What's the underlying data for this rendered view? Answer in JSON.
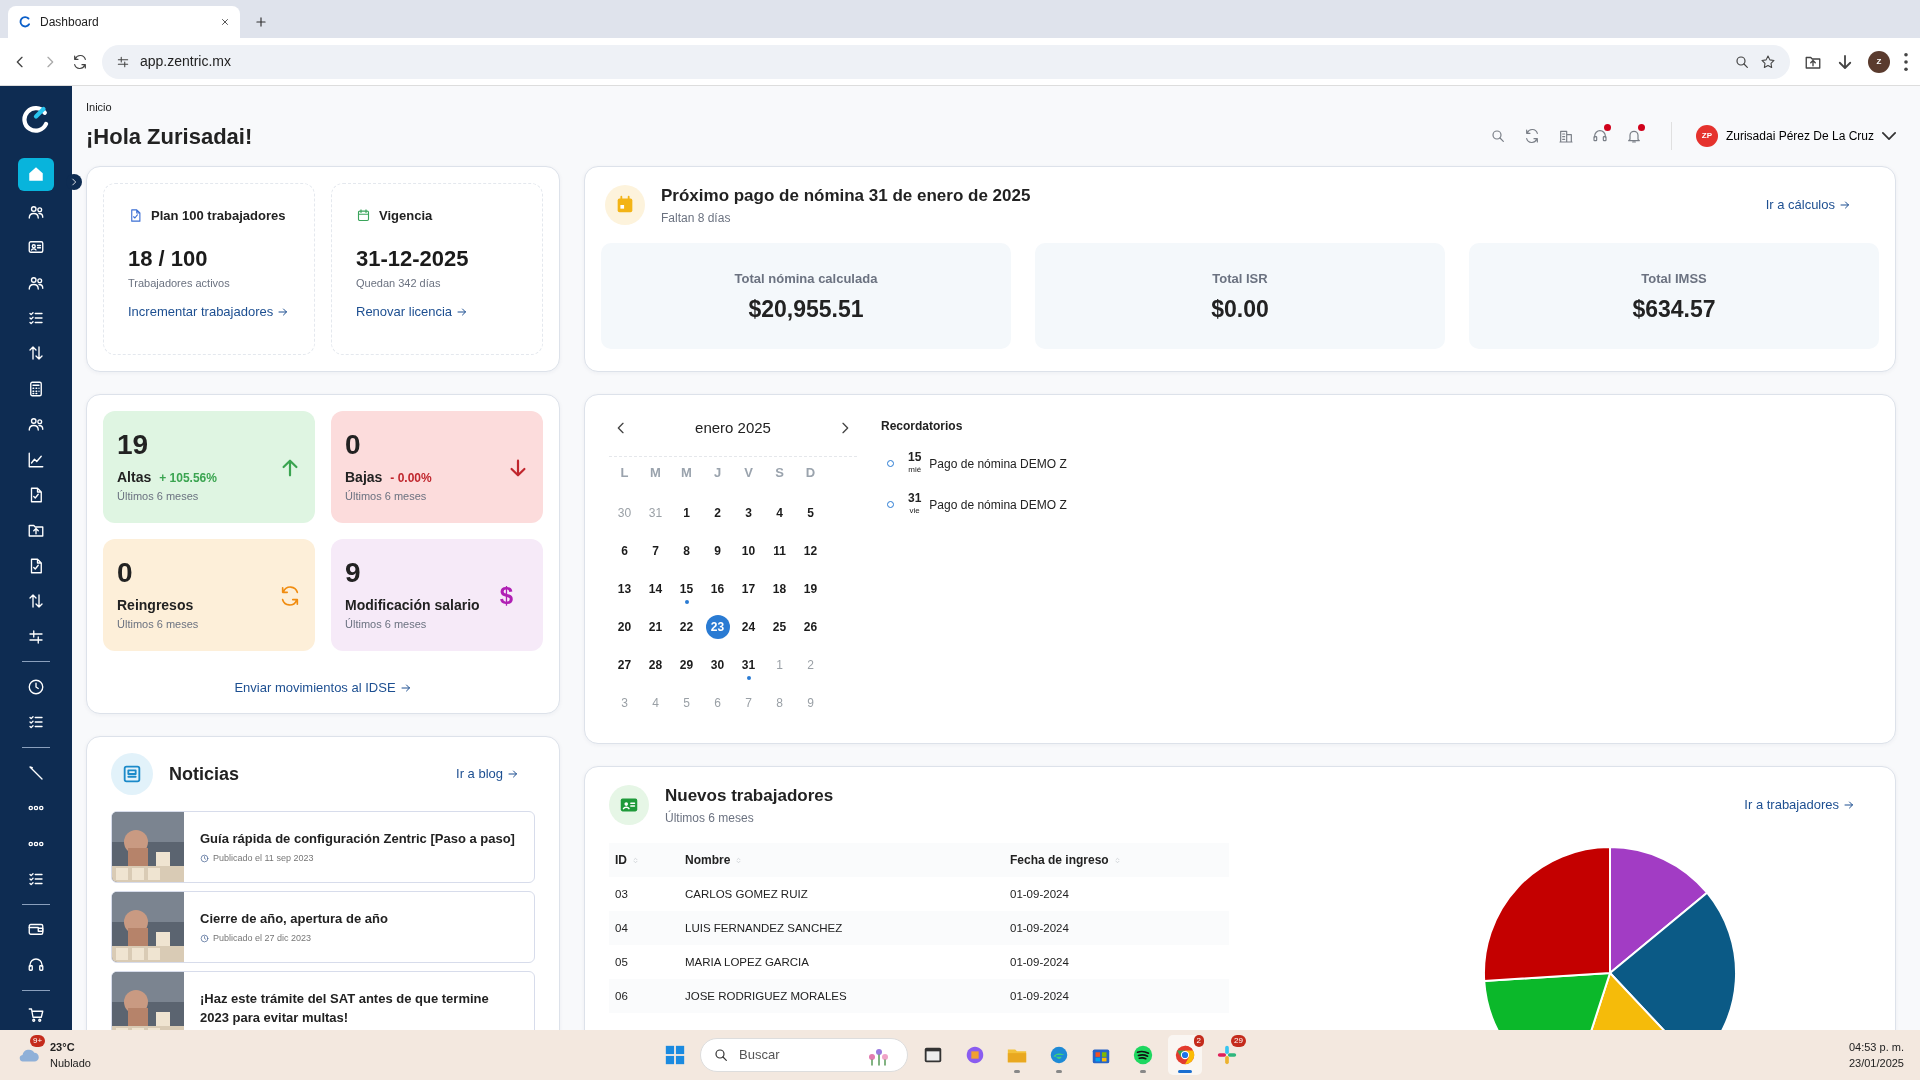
{
  "browser": {
    "tab_title": "Dashboard",
    "url": "app.zentric.mx",
    "profile_initial": "Z"
  },
  "sidebar": {
    "items": [
      {
        "kind": "link",
        "selected": true
      },
      {
        "kind": "link",
        "selected": false
      },
      {
        "kind": "link",
        "selected": false
      },
      {
        "kind": "link",
        "selected": false
      },
      {
        "kind": "link",
        "selected": false
      },
      {
        "kind": "link",
        "selected": false
      },
      {
        "kind": "link",
        "selected": false
      },
      {
        "kind": "link",
        "selected": false
      },
      {
        "kind": "link",
        "selected": false
      },
      {
        "kind": "link",
        "selected": false
      },
      {
        "kind": "link",
        "selected": false
      },
      {
        "kind": "link",
        "selected": false
      },
      {
        "kind": "link",
        "selected": false
      },
      {
        "kind": "link",
        "selected": false
      },
      {
        "kind": "divider"
      },
      {
        "kind": "link",
        "selected": false
      },
      {
        "kind": "link",
        "selected": false
      },
      {
        "kind": "divider"
      },
      {
        "kind": "link",
        "selected": false
      },
      {
        "kind": "link",
        "selected": false
      },
      {
        "kind": "link",
        "selected": false
      },
      {
        "kind": "link",
        "selected": false
      },
      {
        "kind": "divider"
      },
      {
        "kind": "link",
        "selected": false
      },
      {
        "kind": "link",
        "selected": false
      },
      {
        "kind": "divider"
      },
      {
        "kind": "link",
        "selected": false
      }
    ]
  },
  "header": {
    "breadcrumb": "Inicio",
    "greeting": "¡Hola Zurisadai!",
    "toolbar": [
      {
        "alert": false
      },
      {
        "alert": false
      },
      {
        "alert": false
      },
      {
        "alert": true
      },
      {
        "alert": true
      }
    ],
    "user": {
      "initials": "ZP",
      "name": "Zurisadai Pérez De La Cruz"
    }
  },
  "plan_cards": [
    {
      "kind": "plan",
      "title": "Plan 100 trabajadores",
      "value": "18 / 100",
      "caption": "Trabajadores activos",
      "link": "Incrementar trabajadores"
    },
    {
      "kind": "validity",
      "title": "Vigencia",
      "value": "31-12-2025",
      "caption": "Quedan 342 días",
      "link": "Renovar licencia"
    }
  ],
  "movements": {
    "tiles": [
      {
        "kind": "up",
        "value": "19",
        "label": "Altas",
        "change": "+ 105.56%",
        "caption": "Últimos 6 meses"
      },
      {
        "kind": "down",
        "value": "0",
        "label": "Bajas",
        "change": "- 0.00%",
        "caption": "Últimos 6 meses"
      },
      {
        "kind": "return",
        "value": "0",
        "label": "Reingresos",
        "caption": "Últimos 6 meses"
      },
      {
        "kind": "salary",
        "value": "9",
        "label": "Modificación salario",
        "caption": "Últimos 6 meses",
        "symbol": "$"
      }
    ],
    "link": "Enviar movimientos al IDSE"
  },
  "news": {
    "title": "Noticias",
    "link": "Ir a blog",
    "items": [
      {
        "title": "Guía rápida de configuración Zentric [Paso a paso]",
        "date": "Publicado el 11 sep 2023"
      },
      {
        "title": "Cierre de año, apertura de año",
        "date": "Publicado el 27 dic 2023"
      },
      {
        "title": "¡Haz este trámite del SAT antes de que termine 2023 para evitar multas!"
      }
    ]
  },
  "payroll": {
    "title": "Próximo pago de nómina 31 de enero de 2025",
    "subtitle": "Faltan 8 días",
    "link": "Ir a cálculos",
    "totals": [
      {
        "label": "Total nómina calculada",
        "value": "$20,955.51"
      },
      {
        "label": "Total ISR",
        "value": "$0.00"
      },
      {
        "label": "Total IMSS",
        "value": "$634.57"
      }
    ]
  },
  "calendar": {
    "month": "enero 2025",
    "weekdays": [
      "L",
      "M",
      "M",
      "J",
      "V",
      "S",
      "D"
    ],
    "days": [
      {
        "day": "30",
        "outside": true,
        "event": false,
        "selected": false
      },
      {
        "day": "31",
        "outside": true,
        "event": false,
        "selected": false
      },
      {
        "day": "1",
        "outside": false,
        "event": false,
        "selected": false
      },
      {
        "day": "2",
        "outside": false,
        "event": false,
        "selected": false
      },
      {
        "day": "3",
        "outside": false,
        "event": false,
        "selected": false
      },
      {
        "day": "4",
        "outside": false,
        "event": false,
        "selected": false
      },
      {
        "day": "5",
        "outside": false,
        "event": false,
        "selected": false
      },
      {
        "day": "6",
        "outside": false,
        "event": false,
        "selected": false
      },
      {
        "day": "7",
        "outside": false,
        "event": false,
        "selected": false
      },
      {
        "day": "8",
        "outside": false,
        "event": false,
        "selected": false
      },
      {
        "day": "9",
        "outside": false,
        "event": false,
        "selected": false
      },
      {
        "day": "10",
        "outside": false,
        "event": false,
        "selected": false
      },
      {
        "day": "11",
        "outside": false,
        "event": false,
        "selected": false
      },
      {
        "day": "12",
        "outside": false,
        "event": false,
        "selected": false
      },
      {
        "day": "13",
        "outside": false,
        "event": false,
        "selected": false
      },
      {
        "day": "14",
        "outside": false,
        "event": false,
        "selected": false
      },
      {
        "day": "15",
        "outside": false,
        "event": true,
        "selected": false
      },
      {
        "day": "16",
        "outside": false,
        "event": false,
        "selected": false
      },
      {
        "day": "17",
        "outside": false,
        "event": false,
        "selected": false
      },
      {
        "day": "18",
        "outside": false,
        "event": false,
        "selected": false
      },
      {
        "day": "19",
        "outside": false,
        "event": false,
        "selected": false
      },
      {
        "day": "20",
        "outside": false,
        "event": false,
        "selected": false
      },
      {
        "day": "21",
        "outside": false,
        "event": false,
        "selected": false
      },
      {
        "day": "22",
        "outside": false,
        "event": false,
        "selected": false
      },
      {
        "day": "23",
        "outside": false,
        "event": false,
        "selected": true
      },
      {
        "day": "24",
        "outside": false,
        "event": false,
        "selected": false
      },
      {
        "day": "25",
        "outside": false,
        "event": false,
        "selected": false
      },
      {
        "day": "26",
        "outside": false,
        "event": false,
        "selected": false
      },
      {
        "day": "27",
        "outside": false,
        "event": false,
        "selected": false
      },
      {
        "day": "28",
        "outside": false,
        "event": false,
        "selected": false
      },
      {
        "day": "29",
        "outside": false,
        "event": false,
        "selected": false
      },
      {
        "day": "30",
        "outside": false,
        "event": false,
        "selected": false
      },
      {
        "day": "31",
        "outside": false,
        "event": true,
        "selected": false
      },
      {
        "day": "1",
        "outside": true,
        "event": false,
        "selected": false
      },
      {
        "day": "2",
        "outside": true,
        "event": false,
        "selected": false
      },
      {
        "day": "3",
        "outside": true,
        "event": false,
        "selected": false
      },
      {
        "day": "4",
        "outside": true,
        "event": false,
        "selected": false
      },
      {
        "day": "5",
        "outside": true,
        "event": false,
        "selected": false
      },
      {
        "day": "6",
        "outside": true,
        "event": false,
        "selected": false
      },
      {
        "day": "7",
        "outside": true,
        "event": false,
        "selected": false
      },
      {
        "day": "8",
        "outside": true,
        "event": false,
        "selected": false
      },
      {
        "day": "9",
        "outside": true,
        "event": false,
        "selected": false
      }
    ]
  },
  "reminders": {
    "title": "Recordatorios",
    "items": [
      {
        "day": "15",
        "weekday": "mié",
        "text": "Pago de nómina DEMO Z"
      },
      {
        "day": "31",
        "weekday": "vie",
        "text": "Pago de nómina DEMO Z"
      }
    ]
  },
  "new_workers": {
    "title": "Nuevos trabajadores",
    "subtitle": "Últimos 6 meses",
    "link": "Ir a trabajadores",
    "table": {
      "columns": [
        "ID",
        "Nombre",
        "Fecha de ingreso"
      ],
      "rows": [
        [
          "03",
          "CARLOS GOMEZ RUIZ",
          "01-09-2024"
        ],
        [
          "04",
          "LUIS FERNANDEZ SANCHEZ",
          "01-09-2024"
        ],
        [
          "05",
          "MARIA LOPEZ GARCIA",
          "01-09-2024"
        ],
        [
          "06",
          "JOSE RODRIGUEZ MORALES",
          "01-09-2024"
        ]
      ]
    }
  },
  "taskbar": {
    "weather": {
      "badge": "9+",
      "temp": "23°C",
      "condition": "Nublado"
    },
    "search_placeholder": "Buscar",
    "apps": [
      {
        "running": false,
        "active": false
      },
      {
        "running": false,
        "active": false
      },
      {
        "running": true,
        "active": false
      },
      {
        "running": true,
        "active": false
      },
      {
        "running": false,
        "active": false
      },
      {
        "running": true,
        "active": false
      },
      {
        "running": true,
        "active": true,
        "badge": "2"
      },
      {
        "running": false,
        "active": false,
        "badge": "29"
      }
    ],
    "time": "04:53 p. m.",
    "date": "23/01/2025"
  }
}
